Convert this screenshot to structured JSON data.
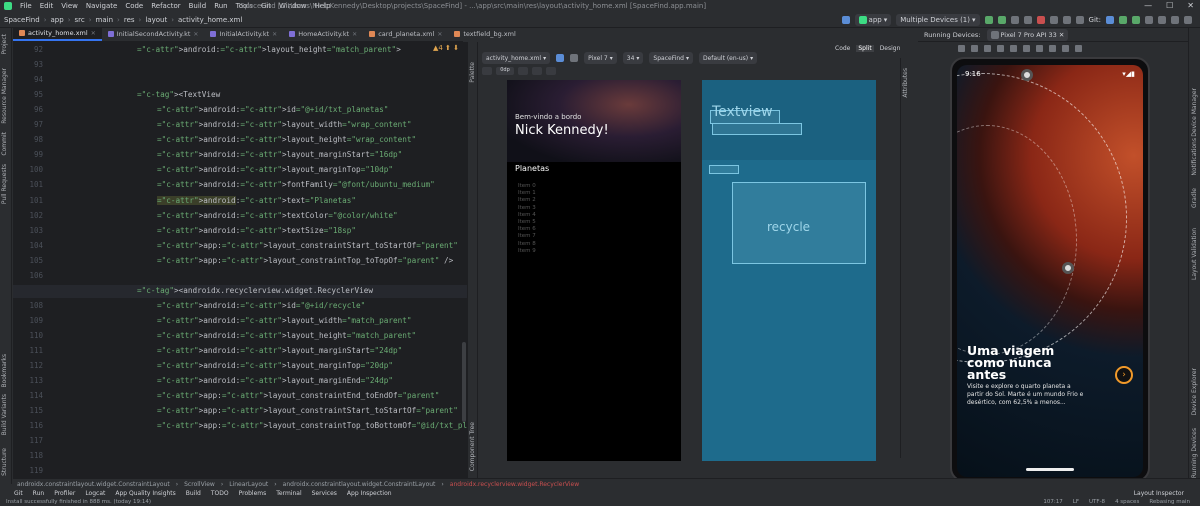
{
  "menu": {
    "items": [
      "File",
      "Edit",
      "View",
      "Navigate",
      "Code",
      "Refactor",
      "Build",
      "Run",
      "Tools",
      "Git",
      "Window",
      "Help"
    ],
    "window_title": "SpaceFind [C:\\Users\\Nick Kennedy\\Desktop\\projects\\SpaceFind] - ...\\app\\src\\main\\res\\layout\\activity_home.xml [SpaceFind.app.main]"
  },
  "nav": {
    "crumbs": [
      "SpaceFind",
      "app",
      "src",
      "main",
      "res",
      "layout",
      "activity_home.xml"
    ],
    "run_config": "app",
    "device": "Multiple Devices (1)",
    "git": "Git:"
  },
  "left_strip": [
    "Project",
    "Resource Manager",
    "Commit",
    "Pull Requests",
    "Bookmarks",
    "Build Variants",
    "Structure"
  ],
  "right_strip": [
    "Gradle",
    "Notifications",
    "Device Manager",
    "Device Explorer",
    "Running Devices",
    "Layout Validation"
  ],
  "tabs": [
    "activity_home.xml",
    "InitialSecondActivity.kt",
    "InitialActivity.kt",
    "HomeActivity.kt",
    "card_planeta.xml",
    "textfield_bg.xml"
  ],
  "editor": {
    "warning": "▲4 ⬆ ⬇",
    "lines": [
      {
        "n": "92",
        "text": "android:layout_height=\"match_parent\">",
        "indent": 0
      },
      {
        "n": "93",
        "text": "",
        "indent": 0
      },
      {
        "n": "94",
        "text": "",
        "indent": 0
      },
      {
        "n": "95",
        "text": "<TextView",
        "indent": 0
      },
      {
        "n": "96",
        "text": "android:id=\"@+id/txt_planetas\"",
        "indent": 1
      },
      {
        "n": "97",
        "text": "android:layout_width=\"wrap_content\"",
        "indent": 1
      },
      {
        "n": "98",
        "text": "android:layout_height=\"wrap_content\"",
        "indent": 1
      },
      {
        "n": "99",
        "text": "android:layout_marginStart=\"16dp\"",
        "indent": 1
      },
      {
        "n": "100",
        "text": "android:layout_marginTop=\"10dp\"",
        "indent": 1
      },
      {
        "n": "101",
        "text": "android:fontFamily=\"@font/ubuntu_medium\"",
        "indent": 1
      },
      {
        "n": "101",
        "text": "android:text=\"Planetas\"",
        "indent": 1
      },
      {
        "n": "102",
        "text": "android:textColor=\"@color/white\"",
        "indent": 1
      },
      {
        "n": "103",
        "text": "android:textSize=\"18sp\"",
        "indent": 1
      },
      {
        "n": "104",
        "text": "app:layout_constraintStart_toStartOf=\"parent\"",
        "indent": 1
      },
      {
        "n": "105",
        "text": "app:layout_constraintTop_toTopOf=\"parent\" />",
        "indent": 1
      },
      {
        "n": "106",
        "text": "",
        "indent": 0
      },
      {
        "n": "107",
        "text": "<androidx.recyclerview.widget.RecyclerView",
        "indent": 0
      },
      {
        "n": "108",
        "text": "android:id=\"@+id/recycle\"",
        "indent": 1
      },
      {
        "n": "109",
        "text": "android:layout_width=\"match_parent\"",
        "indent": 1
      },
      {
        "n": "110",
        "text": "android:layout_height=\"match_parent\"",
        "indent": 1
      },
      {
        "n": "111",
        "text": "android:layout_marginStart=\"24dp\"",
        "indent": 1
      },
      {
        "n": "112",
        "text": "android:layout_marginTop=\"20dp\"",
        "indent": 1
      },
      {
        "n": "113",
        "text": "android:layout_marginEnd=\"24dp\"",
        "indent": 1
      },
      {
        "n": "114",
        "text": "app:layout_constraintEnd_toEndOf=\"parent\"",
        "indent": 1
      },
      {
        "n": "115",
        "text": "app:layout_constraintStart_toStartOf=\"parent\"",
        "indent": 1
      },
      {
        "n": "116",
        "text": "app:layout_constraintTop_toBottomOf=\"@id/txt_planetas\" />",
        "indent": 1
      },
      {
        "n": "117",
        "text": "",
        "indent": 0
      },
      {
        "n": "118",
        "text": "",
        "indent": 0
      },
      {
        "n": "119",
        "text": "",
        "indent": 0
      }
    ]
  },
  "breadcrumbs": [
    "androidx.constraintlayout.widget.ConstraintLayout",
    "ScrollView",
    "LinearLayout",
    "androidx.constraintlayout.widget.ConstraintLayout",
    "androidx.recyclerview.widget.RecyclerView"
  ],
  "design": {
    "file": "activity_home.xml",
    "device": "Pixel 7",
    "api": "34",
    "theme": "SpaceFind",
    "locale": "Default (en-us)",
    "view_modes": [
      "Code",
      "Split",
      "Design"
    ],
    "dp_value": "0dp",
    "preview": {
      "welcome": "Bem-vindo a bordo",
      "name": "Nick Kennedy!",
      "section": "Planetas",
      "items": [
        "Item 0",
        "Item 1",
        "Item 2",
        "Item 3",
        "Item 4",
        "Item 5",
        "Item 6",
        "Item 7",
        "Item 8",
        "Item 9"
      ]
    },
    "blueprint": {
      "textview": "Textview",
      "recycle": "recycle"
    },
    "side_labels": [
      "Palette",
      "Component Tree",
      "Attributes"
    ]
  },
  "running_devices": {
    "label": "Running Devices:",
    "device": "Pixel 7 Pro API 33"
  },
  "phone": {
    "time": "9:16",
    "headline": "Uma viagem como nunca antes",
    "subtitle": "Visite e explore o quarto planeta a partir do Sol. Marte é um mundo Frio e desértico, com 62,5% a menos...",
    "fab": "›"
  },
  "bottom_tools": [
    "Git",
    "Run",
    "Profiler",
    "Logcat",
    "App Quality Insights",
    "Build",
    "TODO",
    "Problems",
    "Terminal",
    "Services",
    "App Inspection"
  ],
  "status": {
    "message": "Install successfully finished in 888 ms. (today 19:14)",
    "position": "107:17",
    "line_sep": "LF",
    "encoding": "UTF-8",
    "indent": "4 spaces",
    "branch": "Rebasing main",
    "layout_inspector": "Layout Inspector"
  },
  "colors": {
    "accent": "#3574f0",
    "editor_bg": "#1e1f22",
    "blueprint": "#1b6180",
    "fab_ring": "#f19a2a"
  }
}
